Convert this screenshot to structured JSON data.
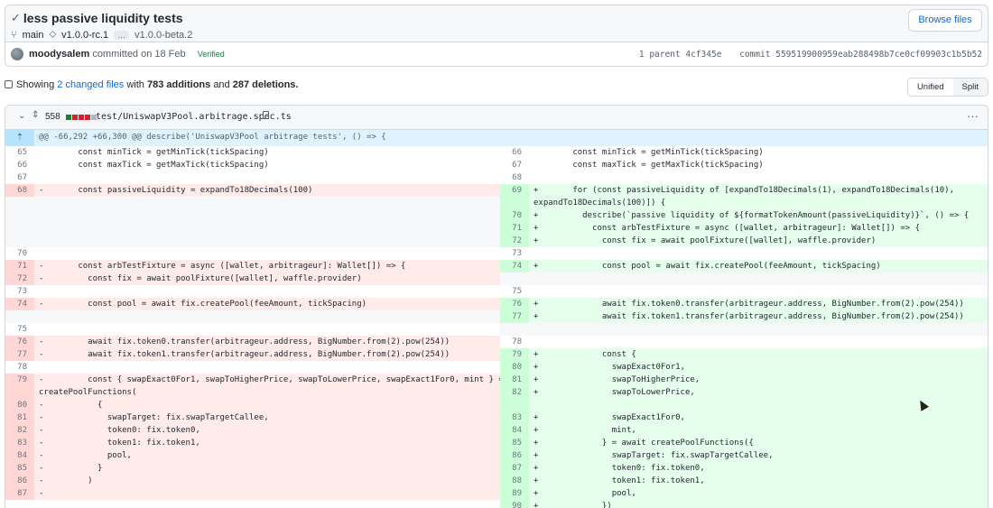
{
  "header": {
    "title": "less passive liquidity tests",
    "branch": "main",
    "tag_primary": "v1.0.0-rc.1",
    "ellipsis": "…",
    "tag_secondary": "v1.0.0-beta.2",
    "browse_label": "Browse files"
  },
  "meta": {
    "author": "moodysalem",
    "committed_text": "committed on 18 Feb",
    "verified": "Verified",
    "parent_label": "1 parent",
    "parent_sha": "4cf345e",
    "commit_label": "commit",
    "commit_sha": "559519900959eab288498b7ce0cf09903c1b5b52"
  },
  "stats": {
    "prefix": "Showing",
    "files_link": "2 changed files",
    "with_text": "with",
    "additions": "783 additions",
    "and_text": "and",
    "deletions": "287 deletions.",
    "unified_label": "Unified",
    "split_label": "Split"
  },
  "file": {
    "count": "558",
    "name": "test/UniswapV3Pool.arbitrage.spec.ts",
    "more": "···",
    "bar_colors": [
      "#1a7f37",
      "#cf222e",
      "#cf222e",
      "#cf222e",
      "#afb8c1"
    ]
  },
  "hunk": {
    "text": "@@ -66,292 +66,300 @@ describe('UniswapV3Pool arbitrage tests', () => {"
  },
  "diff": {
    "left": [
      {
        "n": "65",
        "t": "ctx",
        "c": "        const minTick = getMinTick(tickSpacing)"
      },
      {
        "n": "66",
        "t": "ctx",
        "c": "        const maxTick = getMaxTick(tickSpacing)"
      },
      {
        "n": "67",
        "t": "ctx",
        "c": ""
      },
      {
        "n": "68",
        "t": "del",
        "c": "-       const passiveLiquidity = expandTo18Decimals(100)"
      },
      {
        "n": "",
        "t": "empty",
        "c": ""
      },
      {
        "n": "",
        "t": "empty",
        "c": ""
      },
      {
        "n": "",
        "t": "empty",
        "c": ""
      },
      {
        "n": "",
        "t": "empty",
        "c": ""
      },
      {
        "n": "70",
        "t": "ctx",
        "c": ""
      },
      {
        "n": "71",
        "t": "del",
        "c": "-       const arbTestFixture = async ([wallet, arbitrageur]: Wallet[]) => {"
      },
      {
        "n": "72",
        "t": "del",
        "c": "-         const fix = await poolFixture([wallet], waffle.provider)"
      },
      {
        "n": "73",
        "t": "ctx",
        "c": ""
      },
      {
        "n": "74",
        "t": "del",
        "c": "-         const pool = await fix.createPool(feeAmount, tickSpacing)"
      },
      {
        "n": "",
        "t": "empty",
        "c": ""
      },
      {
        "n": "75",
        "t": "ctx",
        "c": ""
      },
      {
        "n": "76",
        "t": "del",
        "c": "-         await fix.token0.transfer(arbitrageur.address, BigNumber.from(2).pow(254))"
      },
      {
        "n": "77",
        "t": "del",
        "c": "-         await fix.token1.transfer(arbitrageur.address, BigNumber.from(2).pow(254))"
      },
      {
        "n": "78",
        "t": "ctx",
        "c": ""
      },
      {
        "n": "79",
        "t": "del",
        "c": "-         const { swapExact0For1, swapToHigherPrice, swapToLowerPrice, swapExact1For0, mint } = await"
      },
      {
        "n": "",
        "t": "del",
        "c": "createPoolFunctions("
      },
      {
        "n": "80",
        "t": "del",
        "c": "-           {"
      },
      {
        "n": "81",
        "t": "del",
        "c": "-             swapTarget: fix.swapTargetCallee,"
      },
      {
        "n": "82",
        "t": "del",
        "c": "-             token0: fix.token0,"
      },
      {
        "n": "83",
        "t": "del",
        "c": "-             token1: fix.token1,"
      },
      {
        "n": "84",
        "t": "del",
        "c": "-             pool,"
      },
      {
        "n": "85",
        "t": "del",
        "c": "-           }"
      },
      {
        "n": "86",
        "t": "del",
        "c": "-         )"
      },
      {
        "n": "87",
        "t": "del",
        "c": "-"
      }
    ],
    "right": [
      {
        "n": "66",
        "t": "ctx",
        "c": "        const minTick = getMinTick(tickSpacing)"
      },
      {
        "n": "67",
        "t": "ctx",
        "c": "        const maxTick = getMaxTick(tickSpacing)"
      },
      {
        "n": "68",
        "t": "ctx",
        "c": ""
      },
      {
        "n": "69",
        "t": "add",
        "c": "+       for (const passiveLiquidity of [expandTo18Decimals(1), expandTo18Decimals(10),"
      },
      {
        "n": "",
        "t": "add",
        "c": "expandTo18Decimals(100)]) {"
      },
      {
        "n": "70",
        "t": "add",
        "c": "+         describe(`passive liquidity of ${formatTokenAmount(passiveLiquidity)}`, () => {"
      },
      {
        "n": "71",
        "t": "add",
        "c": "+           const arbTestFixture = async ([wallet, arbitrageur]: Wallet[]) => {"
      },
      {
        "n": "72",
        "t": "add",
        "c": "+             const fix = await poolFixture([wallet], waffle.provider)"
      },
      {
        "n": "73",
        "t": "ctx",
        "c": ""
      },
      {
        "n": "74",
        "t": "add",
        "c": "+             const pool = await fix.createPool(feeAmount, tickSpacing)"
      },
      {
        "n": "",
        "t": "empty",
        "c": ""
      },
      {
        "n": "75",
        "t": "ctx",
        "c": ""
      },
      {
        "n": "76",
        "t": "add",
        "c": "+             await fix.token0.transfer(arbitrageur.address, BigNumber.from(2).pow(254))"
      },
      {
        "n": "77",
        "t": "add",
        "c": "+             await fix.token1.transfer(arbitrageur.address, BigNumber.from(2).pow(254))"
      },
      {
        "n": "",
        "t": "empty",
        "c": ""
      },
      {
        "n": "78",
        "t": "ctx",
        "c": ""
      },
      {
        "n": "79",
        "t": "add",
        "c": "+             const {"
      },
      {
        "n": "80",
        "t": "add",
        "c": "+               swapExact0For1,"
      },
      {
        "n": "81",
        "t": "add",
        "c": "+               swapToHigherPrice,"
      },
      {
        "n": "82",
        "t": "add",
        "c": "+               swapToLowerPrice,"
      },
      {
        "n": "",
        "t": "add",
        "c": ""
      },
      {
        "n": "83",
        "t": "add",
        "c": "+               swapExact1For0,"
      },
      {
        "n": "84",
        "t": "add",
        "c": "+               mint,"
      },
      {
        "n": "85",
        "t": "add",
        "c": "+             } = await createPoolFunctions({"
      },
      {
        "n": "86",
        "t": "add",
        "c": "+               swapTarget: fix.swapTargetCallee,"
      },
      {
        "n": "87",
        "t": "add",
        "c": "+               token0: fix.token0,"
      },
      {
        "n": "88",
        "t": "add",
        "c": "+               token1: fix.token1,"
      },
      {
        "n": "89",
        "t": "add",
        "c": "+               pool,"
      },
      {
        "n": "90",
        "t": "add",
        "c": "+             })"
      }
    ]
  }
}
